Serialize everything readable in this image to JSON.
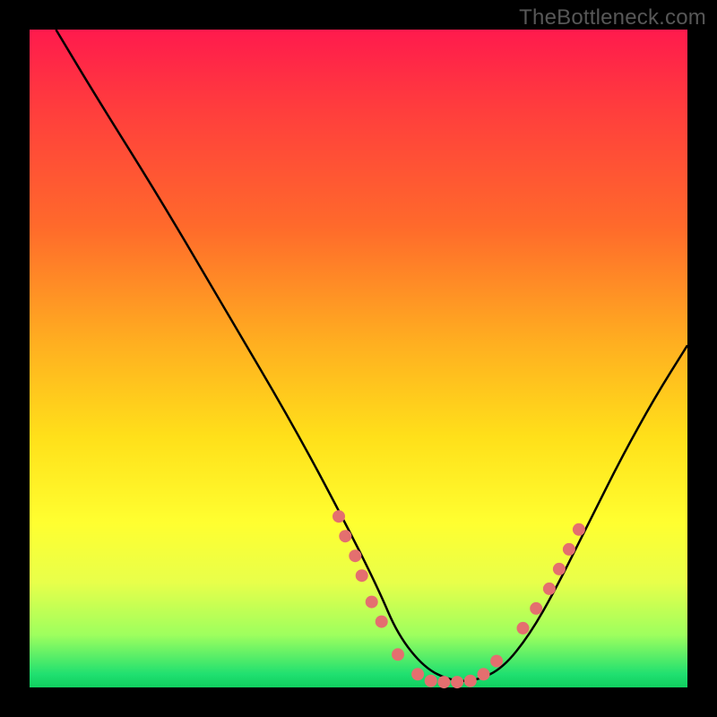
{
  "watermark": "TheBottleneck.com",
  "colors": {
    "background": "#000000",
    "gradient_top": "#ff1a4d",
    "gradient_mid1": "#ff6a2b",
    "gradient_mid2": "#ffe01a",
    "gradient_bottom": "#10d060",
    "curve_stroke": "#000000",
    "marker_fill": "#e46f6f"
  },
  "chart_data": {
    "type": "line",
    "title": "",
    "xlabel": "",
    "ylabel": "",
    "xlim": [
      0,
      100
    ],
    "ylim": [
      0,
      100
    ],
    "grid": false,
    "legend": false,
    "annotations": [],
    "series": [
      {
        "name": "curve",
        "x": [
          4,
          10,
          20,
          30,
          40,
          48,
          53,
          56,
          60,
          64,
          68,
          72,
          76,
          80,
          85,
          90,
          95,
          100
        ],
        "y": [
          100,
          90,
          74,
          57,
          40,
          25,
          15,
          8,
          3,
          1,
          1,
          3,
          8,
          15,
          25,
          35,
          44,
          52
        ]
      }
    ],
    "markers": [
      {
        "x": 47,
        "y": 26
      },
      {
        "x": 48,
        "y": 23
      },
      {
        "x": 49.5,
        "y": 20
      },
      {
        "x": 50.5,
        "y": 17
      },
      {
        "x": 52,
        "y": 13
      },
      {
        "x": 53.5,
        "y": 10
      },
      {
        "x": 56,
        "y": 5
      },
      {
        "x": 59,
        "y": 2
      },
      {
        "x": 61,
        "y": 1
      },
      {
        "x": 63,
        "y": 0.8
      },
      {
        "x": 65,
        "y": 0.8
      },
      {
        "x": 67,
        "y": 1
      },
      {
        "x": 69,
        "y": 2
      },
      {
        "x": 71,
        "y": 4
      },
      {
        "x": 75,
        "y": 9
      },
      {
        "x": 77,
        "y": 12
      },
      {
        "x": 79,
        "y": 15
      },
      {
        "x": 80.5,
        "y": 18
      },
      {
        "x": 82,
        "y": 21
      },
      {
        "x": 83.5,
        "y": 24
      }
    ]
  }
}
